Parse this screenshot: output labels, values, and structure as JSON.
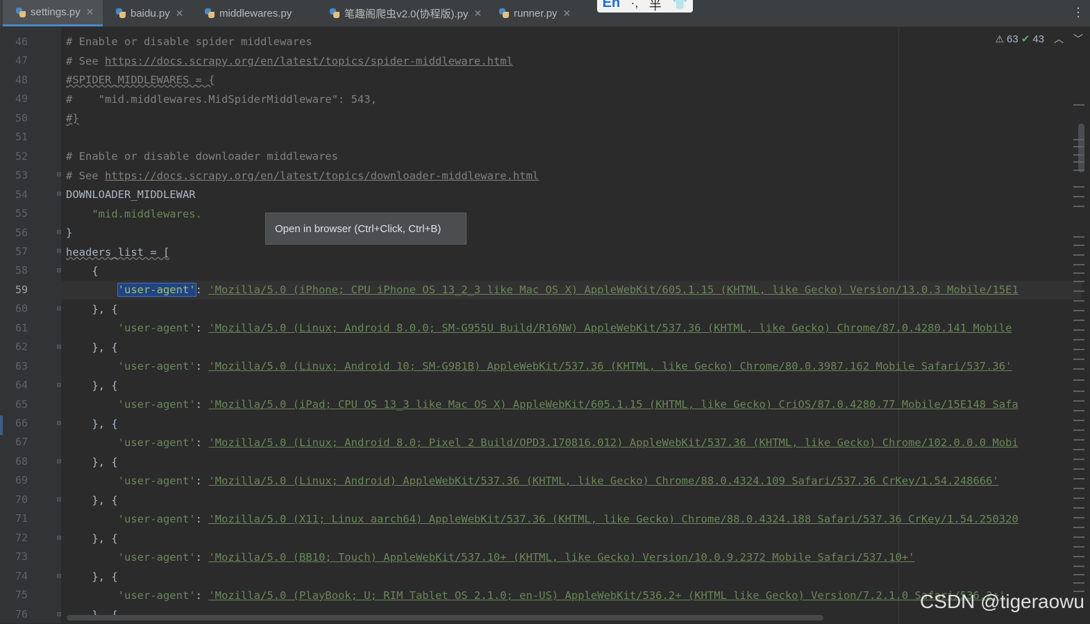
{
  "tabs": [
    {
      "label": "settings.py",
      "active": true
    },
    {
      "label": "baidu.py",
      "active": false
    },
    {
      "label": "middlewares.py",
      "active": false
    },
    {
      "label": "笔趣阁爬虫v2.0(协程版).py",
      "active": false
    },
    {
      "label": "runner.py",
      "active": false
    }
  ],
  "ime": {
    "lang": "En",
    "punct": "·,",
    "width": "半"
  },
  "inspection": {
    "warnings": "63",
    "ok": "43"
  },
  "tooltip": "Open in browser (Ctrl+Click, Ctrl+B)",
  "watermark": "CSDN @tigeraowu",
  "line_numbers": [
    "46",
    "47",
    "48",
    "49",
    "50",
    "51",
    "52",
    "53",
    "54",
    "55",
    "56",
    "57",
    "58",
    "59",
    "60",
    "61",
    "62",
    "63",
    "64",
    "65",
    "66",
    "67",
    "68",
    "69",
    "70",
    "71",
    "72",
    "73",
    "74",
    "75",
    "76"
  ],
  "current_line": "59",
  "code": {
    "l46": "# Enable or disable spider middlewares",
    "l47_prefix": "# See ",
    "l47_url": "https://docs.scrapy.org/en/latest/topics/spider-middleware.html",
    "l48": "#SPIDER_MIDDLEWARES = {",
    "l49": "#    \"mid.middlewares.MidSpiderMiddleware\": 543,",
    "l50": "#}",
    "l52": "# Enable or disable downloader middlewares",
    "l53_prefix": "# See ",
    "l53_url": "https://docs.scrapy.org/en/latest/topics/downloader-middleware.html",
    "l54": "DOWNLOADER_MIDDLEWAR",
    "l55": "\"mid.middlewares.",
    "l55_tail": ",",
    "l56": "}",
    "l57": "headers_list = [",
    "l58": "{",
    "close_open": "}, {",
    "close_last": "}, {",
    "key": "'user-agent'",
    "colon": ":",
    "ua": [
      "'Mozilla/5.0 (iPhone; CPU iPhone OS 13_2_3 like Mac OS X) AppleWebKit/605.1.15 (KHTML, like Gecko) Version/13.0.3 Mobile/15E1",
      "'Mozilla/5.0 (Linux; Android 8.0.0; SM-G955U Build/R16NW) AppleWebKit/537.36 (KHTML, like Gecko) Chrome/87.0.4280.141 Mobile",
      "'Mozilla/5.0 (Linux; Android 10; SM-G981B) AppleWebKit/537.36 (KHTML, like Gecko) Chrome/80.0.3987.162 Mobile Safari/537.36'",
      "'Mozilla/5.0 (iPad; CPU OS 13_3 like Mac OS X) AppleWebKit/605.1.15 (KHTML, like Gecko) CriOS/87.0.4280.77 Mobile/15E148 Safa",
      "'Mozilla/5.0 (Linux; Android 8.0; Pixel 2 Build/OPD3.170816.012) AppleWebKit/537.36 (KHTML, like Gecko) Chrome/102.0.0.0 Mobi",
      "'Mozilla/5.0 (Linux; Android) AppleWebKit/537.36 (KHTML, like Gecko) Chrome/88.0.4324.109 Safari/537.36 CrKey/1.54.248666'",
      "'Mozilla/5.0 (X11; Linux aarch64) AppleWebKit/537.36 (KHTML, like Gecko) Chrome/88.0.4324.188 Safari/537.36 CrKey/1.54.250320",
      "'Mozilla/5.0 (BB10; Touch) AppleWebKit/537.10+ (KHTML, like Gecko) Version/10.0.9.2372 Mobile Safari/537.10+'",
      "'Mozilla/5.0 (PlayBook; U; RIM Tablet OS 2.1.0; en-US) AppleWebKit/536.2+ (KHTML like Gecko) Version/7.2.1.0 Safari/536.2+'"
    ]
  }
}
